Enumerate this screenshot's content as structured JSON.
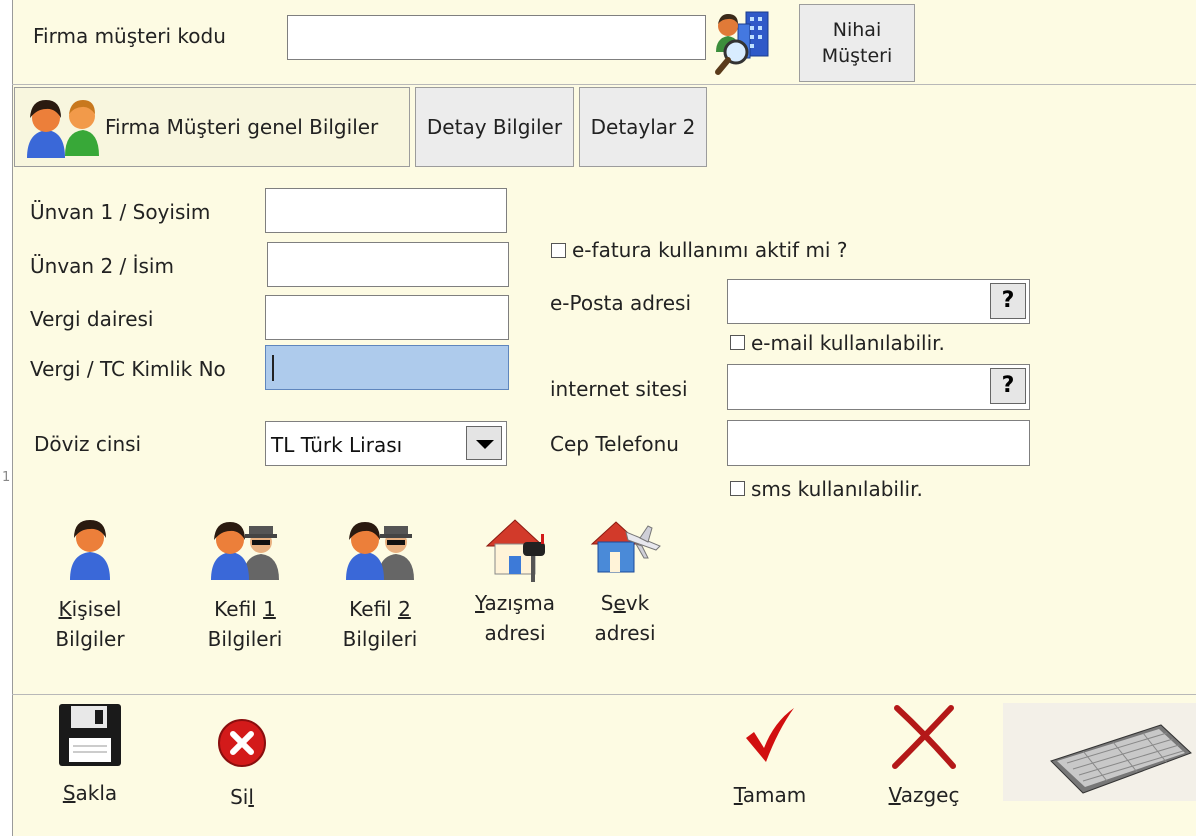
{
  "header": {
    "customer_code_label": "Firma müşteri kodu",
    "customer_code_value": "",
    "final_customer_button": "Nihai Müşteri"
  },
  "tabs": [
    {
      "label": "Firma Müşteri genel Bilgiler"
    },
    {
      "label": "Detay Bilgiler"
    },
    {
      "label": "Detaylar 2"
    }
  ],
  "form": {
    "title1_label": "Ünvan 1 / Soyisim",
    "title1_value": "",
    "title2_label": "Ünvan 2 / İsim",
    "title2_value": "",
    "tax_office_label": "Vergi dairesi",
    "tax_office_value": "",
    "tax_id_label": "Vergi / TC Kimlik No",
    "tax_id_value": "",
    "currency_label": "Döviz cinsi",
    "currency_value": "TL Türk Lirası",
    "efatura_label": "e-fatura kullanımı aktif mi ?",
    "efatura_checked": false,
    "email_label": "e-Posta adresi",
    "email_value": "",
    "email_usable_label": "e-mail kullanılabilir.",
    "email_usable_checked": false,
    "website_label": "internet sitesi",
    "website_value": "",
    "mobile_label": "Cep Telefonu",
    "mobile_value": "",
    "sms_label": "sms kullanılabilir.",
    "sms_checked": false,
    "help_glyph": "?"
  },
  "actions": {
    "personal": {
      "accel": "K",
      "rest": "işisel",
      "line2": "Bilgiler"
    },
    "guarantor1": {
      "pre": "Kefil ",
      "accel": "1",
      "line2": "Bilgileri"
    },
    "guarantor2": {
      "pre": "Kefil ",
      "accel": "2",
      "line2": "Bilgileri"
    },
    "correspondence": {
      "accel": "Y",
      "rest": "azışma",
      "line2": "adresi"
    },
    "shipping": {
      "pre": "S",
      "accel": "e",
      "rest": "vk",
      "line2": "adresi"
    }
  },
  "footer": {
    "save": {
      "accel": "S",
      "rest": "akla"
    },
    "delete": {
      "pre": "Si",
      "accel": "l"
    },
    "ok": {
      "accel": "T",
      "rest": "amam"
    },
    "cancel": {
      "accel": "V",
      "rest": "azgeç"
    }
  },
  "edge_marks": [
    "1"
  ],
  "icons": {
    "search": "customer-search-icon",
    "people": "people-icon",
    "person": "person-icon",
    "guarantor": "guarantor-icon",
    "mailbox": "mailbox-house-icon",
    "shipping": "house-plane-icon",
    "floppy": "floppy-disk-icon",
    "delete": "delete-x-icon",
    "check": "checkmark-icon",
    "cancel": "red-x-icon",
    "keyboard": "keyboard-icon"
  },
  "colors": {
    "background": "#fdfbe3",
    "active_input": "#aecbec",
    "accent_red": "#d10f0f"
  }
}
